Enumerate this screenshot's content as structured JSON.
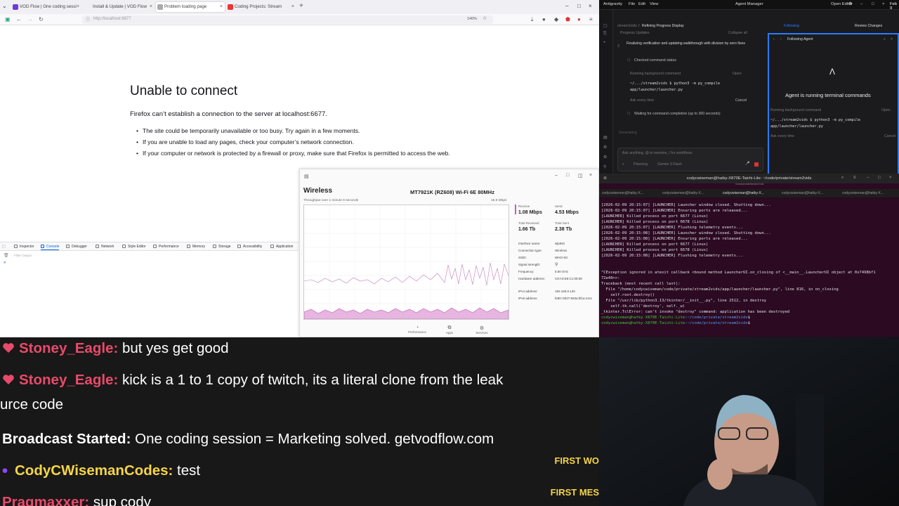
{
  "firefox": {
    "tabs": [
      {
        "label": "VOD Flow | One coding sessi",
        "active": false
      },
      {
        "label": "Install & Update | VOD Flow",
        "active": false
      },
      {
        "label": "Problem loading page",
        "active": true
      },
      {
        "label": "Coding Projects: Stream",
        "active": false
      }
    ],
    "url": "http://localhost:6677",
    "zoom": "140%",
    "error_title": "Unable to connect",
    "error_desc": "Firefox can’t establish a connection to the server at localhost:6677.",
    "error_items": [
      "The site could be temporarily unavailable or too busy. Try again in a few moments.",
      "If you are unable to load any pages, check your computer’s network connection.",
      "If your computer or network is protected by a firewall or proxy, make sure that Firefox is permitted to access the web."
    ],
    "devtools_tabs": [
      "Inspector",
      "Console",
      "Debugger",
      "Network",
      "Style Editor",
      "Performance",
      "Memory",
      "Storage",
      "Accessibility",
      "Application"
    ],
    "devtools_filter": "Filter Output"
  },
  "sysmon": {
    "title": "Wireless",
    "device": "MT7921K (RZ608) Wi-Fi 6E 80MHz",
    "subtitle": "Throughput over 1 minute 6 seconds",
    "max": "16.8 Mbps",
    "receive_label": "Receive",
    "receive_value": "1.08 Mbps",
    "send_label": "Send",
    "send_value": "4.53 Mbps",
    "total_received_label": "Total Received",
    "total_received_value": "1.66 Tb",
    "total_sent_label": "Total Sent",
    "total_sent_value": "2.38 Tb",
    "info": [
      {
        "label": "Interface name:",
        "value": "wlp9s0"
      },
      {
        "label": "Connection type:",
        "value": "Wireless"
      },
      {
        "label": "SSID:",
        "value": "WHO-5G"
      },
      {
        "label": "Signal strength:",
        "value": ""
      },
      {
        "label": "Frequency:",
        "value": "5.80 GHz"
      },
      {
        "label": "Hardware address:",
        "value": "C8:A3:E8:C1:08:69"
      },
      {
        "label": "IPv4 address:",
        "value": "192.168.0.140"
      },
      {
        "label": "IPv6 address:",
        "value": "fe80::5027:693a:bf1a:14cc"
      }
    ],
    "nav": [
      "Performance",
      "Apps",
      "Services"
    ]
  },
  "antigravity": {
    "menu": [
      "Antigravity",
      "File",
      "Edit",
      "View"
    ],
    "agent_manager": "Agent Manager",
    "open_editor": "Open Editor",
    "breadcrumb": "stream2vids",
    "task_title": "Refining Progress Display",
    "review_changes": "Review Changes",
    "following": "Following",
    "progress_updates": "Progress Updates",
    "collapse_all": "Collapse all",
    "step_text": "Finalizing verification and updating walkthrough with division by zero fixes",
    "checked_status": "Checked command status",
    "running_bg": "Running background command",
    "open": "Open",
    "command": "~/.../stream2vids $ python3 -m py_compile app/launcher/launcher.py",
    "ask_every_time": "Ask every time",
    "cancel": "Cancel",
    "waiting": "Waiting for command completion (up to 300 seconds)",
    "generating": "Generating",
    "input_placeholder": "Ask anything, @ to mention, / for workflows",
    "mode": "Planning",
    "model": "Gemini 3 Flash",
    "panel_title": "Following Agent",
    "panel_msg": "Agent is running terminal commands"
  },
  "terminal": {
    "title": "codycwiseman@hatky-X870E-Taichi-Lite: ~/code/private/stream2vids",
    "subtitle": "~/code/private/stream2vids",
    "tabs": [
      "codycwiseman@hatky-X...",
      "codycwiseman@hatky-X...",
      "codycwiseman@hatky-X...",
      "codycwiseman@hatky-X...",
      "codycwiseman@hatky-X..."
    ],
    "lines": [
      "[2026-02-09 20:15:07] [LAUNCHER] Launcher window closed. Shutting down...",
      "[2026-02-09 20:15:07] [LAUNCHER] Ensuring ports are released...",
      "[LAUNCHER] Killed process on port 6677 (Linux)",
      "[LAUNCHER] Killed process on port 6678 (Linux)",
      "[2026-02-09 20:15:07] [LAUNCHER] Flushing telemetry events...",
      "[2026-02-09 20:15:08] [LAUNCHER] Launcher window closed. Shutting down...",
      "[2026-02-09 20:15:08] [LAUNCHER] Ensuring ports are released...",
      "[LAUNCHER] Killed process on port 6677 (Linux)",
      "[LAUNCHER] Killed process on port 6678 (Linux)",
      "[2026-02-09 20:15:08] [LAUNCHER] Flushing telemetry events...",
      "",
      "",
      "^CException ignored in atexit callback <bound method LauncherUI.on_closing of <__main__.LauncherUI object at 0x7498bf1",
      "72e40>>:",
      "Traceback (most recent call last):",
      "  File \"/home/codycwiseman/code/private/stream2vids/app/launcher/launcher.py\", line 816, in on_closing",
      "    self.root.destroy()",
      "  File \"/usr/lib/python3.13/tkinter/__init__.py\", line 2512, in destroy",
      "    self.tk.call('destroy', self._w)",
      "_tkinter.TclError: can't invoke \"destroy\" command: application has been destroyed"
    ],
    "prompt_user": "codycwiseman@hatky-X870E-Taichi-Lite",
    "prompt_path": ":~/code/private/stream2vids",
    "prompt_symbol": "$"
  },
  "chat": {
    "messages": [
      {
        "user": "Stoney_Eagle",
        "sep": ":",
        "text": " but yes get good",
        "color": "#e84a6a",
        "badge": "heart"
      },
      {
        "user": "Stoney_Eagle",
        "sep": ":",
        "text": " kick is a 1 to 1 copy of twitch, its a literal clone from the leak",
        "color": "#e84a6a",
        "badge": "heart"
      },
      {
        "user": "",
        "sep": "",
        "text": "urce code",
        "color": "#fff",
        "badge": ""
      },
      {
        "user": "Broadcast Started",
        "sep": ":",
        "text": " One coding session = Marketing solved. getvodflow.com",
        "color": "#ffffff",
        "badge": ""
      },
      {
        "user": "CodyCWisemanCodes",
        "sep": ":",
        "text": " test",
        "color": "#f5d547",
        "badge": "sub"
      },
      {
        "user": "Pragmaxxer",
        "sep": ":",
        "text": " sup cody",
        "color": "#e84a6a",
        "badge": ""
      }
    ],
    "first_labels": [
      "FIRST WO",
      "FIRST MES"
    ]
  },
  "clock": "Feb 9"
}
